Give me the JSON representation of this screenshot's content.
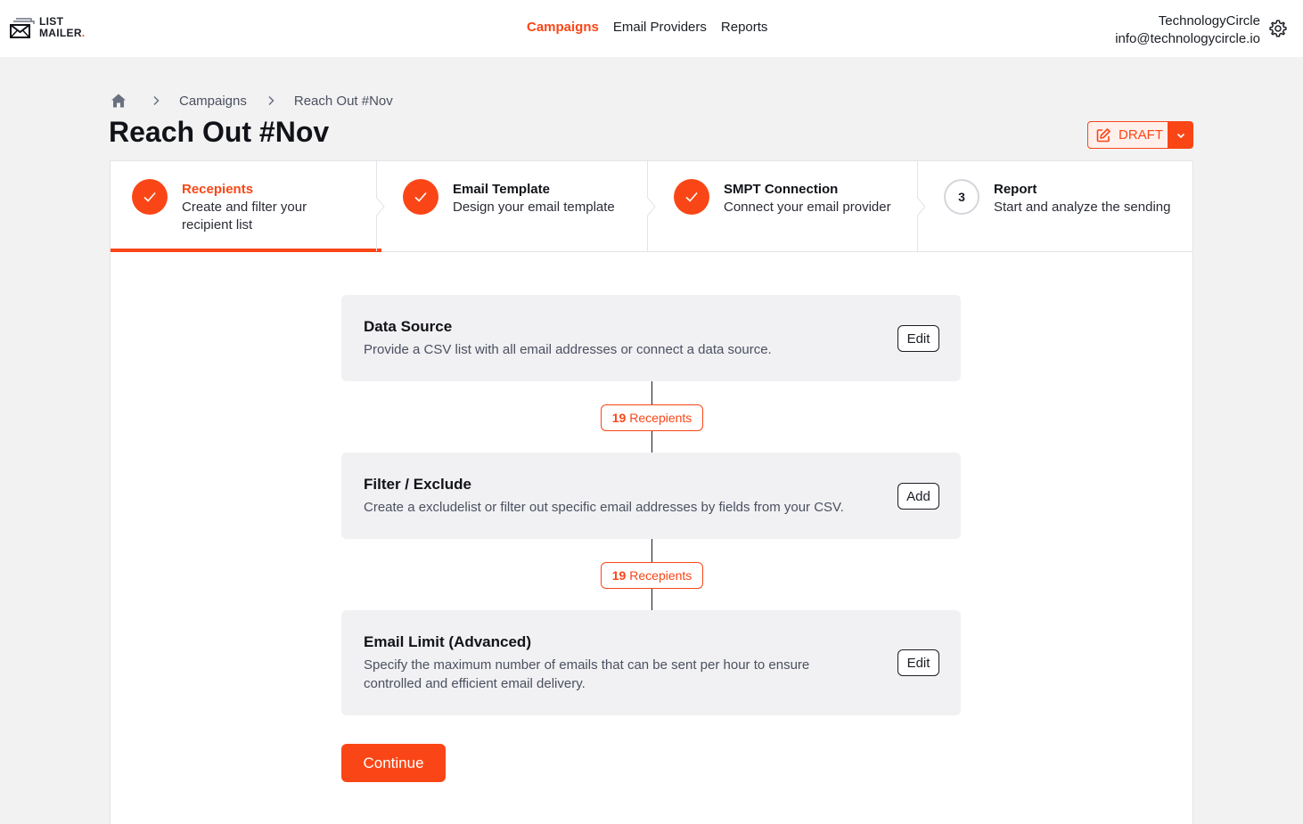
{
  "brand": {
    "line1": "LIST",
    "line2": "MAILER",
    "accent_dot": ".",
    "accent_color": "#fa4616"
  },
  "nav": {
    "items": [
      {
        "label": "Campaigns",
        "active": true
      },
      {
        "label": "Email Providers",
        "active": false
      },
      {
        "label": "Reports",
        "active": false
      }
    ]
  },
  "account": {
    "name": "TechnologyCircle",
    "email": "info@technologycircle.io",
    "settings_icon": "gear-icon"
  },
  "breadcrumb": {
    "home_icon": "home-icon",
    "items": [
      "Campaigns",
      "Reach Out #Nov"
    ]
  },
  "page": {
    "title": "Reach Out #Nov"
  },
  "status": {
    "label": "DRAFT",
    "icon": "edit-icon",
    "toggle_icon": "chevron-down-icon"
  },
  "steps": [
    {
      "title": "Recepients",
      "desc": "Create and filter your recipient list",
      "state": "done",
      "active": true
    },
    {
      "title": "Email Template",
      "desc": "Design your email template",
      "state": "done",
      "active": false
    },
    {
      "title": "SMPT Connection",
      "desc": "Connect your email provider",
      "state": "done",
      "active": false
    },
    {
      "title": "Report",
      "desc": "Start and analyze the sending",
      "state": "pending",
      "number": "3",
      "active": false
    }
  ],
  "sections": [
    {
      "title": "Data Source",
      "desc": "Provide a CSV list with all email addresses or connect a data source.",
      "button": "Edit"
    },
    {
      "title": "Filter / Exclude",
      "desc": "Create a excludelist or filter out specific email addresses by fields from your CSV.",
      "button": "Add"
    },
    {
      "title": "Email Limit (Advanced)",
      "desc": "Specify the maximum number of emails that can be sent per hour to ensure controlled and efficient email delivery.",
      "button": "Edit"
    }
  ],
  "counts": [
    {
      "number": "19",
      "label": "Recepients"
    },
    {
      "number": "19",
      "label": "Recepients"
    }
  ],
  "continue_label": "Continue"
}
